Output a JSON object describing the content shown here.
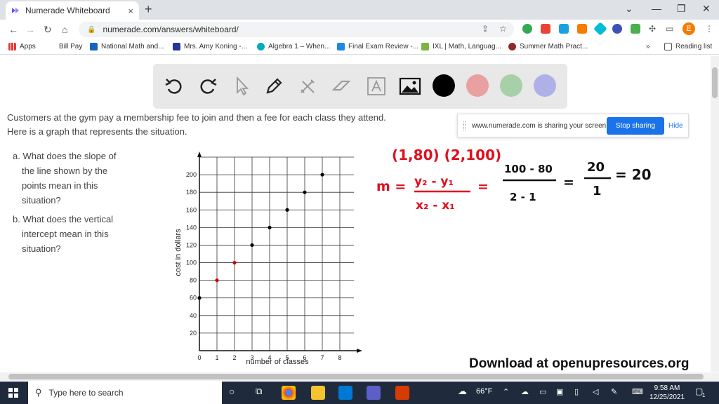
{
  "browser": {
    "tab_title": "Numerade Whiteboard",
    "tab_close": "×",
    "new_tab": "+",
    "url": "numerade.com/answers/whiteboard/",
    "bookmarks": [
      "Apps",
      "Bill Pay",
      "National Math and...",
      "Mrs. Amy Koning -...",
      "Algebra 1 – When...",
      "Final Exam Review -...",
      "IXL | Math, Languag...",
      "Summer Math Pract..."
    ],
    "bookmarks_more": "»",
    "reading_list": "Reading list",
    "avatar_letter": "E"
  },
  "toolbar": {
    "tools": [
      "undo-icon",
      "redo-icon",
      "pointer-icon",
      "pen-icon",
      "tools-icon",
      "eraser-icon",
      "text-icon",
      "image-icon"
    ],
    "colors": [
      "#000000",
      "#e8a0a0",
      "#a8d0a8",
      "#b0b0e8"
    ]
  },
  "problem": {
    "line1": "Customers at the gym pay a membership fee to join and then a fee for each class they attend.",
    "line2": "Here is a graph that represents the situation.",
    "a_lines": [
      "a. What does the slope of",
      "the line shown by the",
      "points mean in this",
      "situation?"
    ],
    "b_lines": [
      "b. What does the vertical",
      "intercept mean in this",
      "situation?"
    ]
  },
  "share_bar": {
    "message": "www.numerade.com is sharing your screen.",
    "stop": "Stop sharing",
    "hide": "Hide"
  },
  "chart_data": {
    "type": "scatter",
    "xlabel": "number of classes",
    "ylabel": "cost in dollars",
    "x_ticks": [
      0,
      1,
      2,
      3,
      4,
      5,
      6,
      7,
      8
    ],
    "y_ticks": [
      20,
      40,
      60,
      80,
      100,
      120,
      140,
      160,
      180,
      200
    ],
    "xlim": [
      0,
      8.8
    ],
    "ylim": [
      0,
      220
    ],
    "points": [
      {
        "x": 0,
        "y": 60,
        "color": "#000000"
      },
      {
        "x": 1,
        "y": 80,
        "color": "#d00000"
      },
      {
        "x": 2,
        "y": 100,
        "color": "#d00000"
      },
      {
        "x": 3,
        "y": 120,
        "color": "#000000"
      },
      {
        "x": 4,
        "y": 140,
        "color": "#000000"
      },
      {
        "x": 5,
        "y": 160,
        "color": "#000000"
      },
      {
        "x": 6,
        "y": 180,
        "color": "#000000"
      },
      {
        "x": 7,
        "y": 200,
        "color": "#000000"
      }
    ],
    "grid": true
  },
  "handwriting": {
    "points": "(1,80) (2,100)",
    "m": "m =",
    "num": "y₂ - y₁",
    "den": "x₂ - x₁",
    "eq1": "=",
    "num2": "100 - 80",
    "den2": "2 - 1",
    "eq2": "=",
    "num3": "20",
    "den3": "1",
    "result": "= 20"
  },
  "footer": {
    "download": "Download at openupresources.org"
  },
  "taskbar": {
    "search_placeholder": "Type here to search",
    "weather": "66°F",
    "time": "9:58 AM",
    "date": "12/25/2021",
    "notif_count": "1"
  }
}
